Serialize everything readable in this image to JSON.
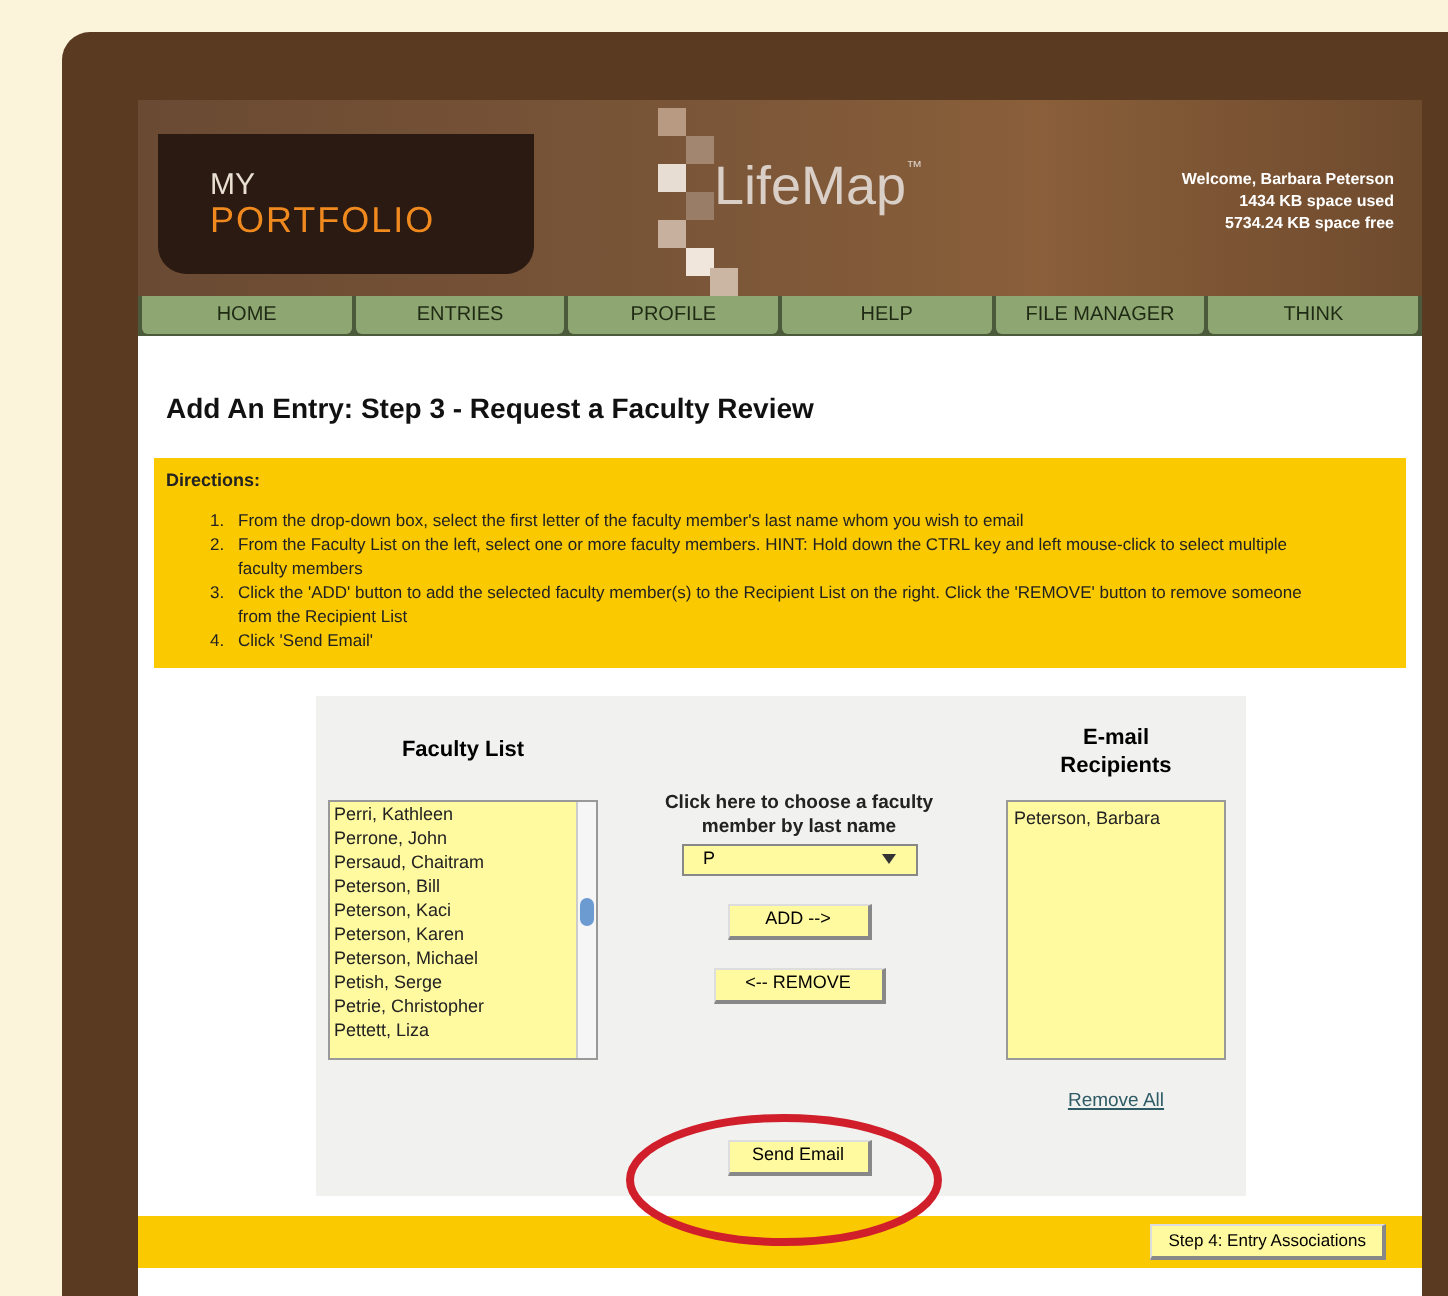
{
  "header": {
    "logo_top": "MY",
    "logo_bottom": "PORTFOLIO",
    "brand": "LifeMap",
    "brand_mark": "™",
    "welcome": "Welcome, Barbara Peterson",
    "space_used": "1434 KB space used",
    "space_free": "5734.24 KB space free"
  },
  "nav": [
    "HOME",
    "ENTRIES",
    "PROFILE",
    "HELP",
    "FILE MANAGER",
    "THINK"
  ],
  "title": "Add An Entry: Step 3 - Request a Faculty Review",
  "directions": {
    "heading": "Directions:",
    "steps": [
      {
        "number": "1.",
        "text": "From the drop-down box, select the first letter of the faculty member's last name whom you wish to email"
      },
      {
        "number": "2.",
        "text": "From the Faculty List on the left, select one or more faculty members. HINT: Hold down the CTRL key and left mouse-click to select multiple faculty members"
      },
      {
        "number": "3.",
        "text": "Click the 'ADD' button to add the selected faculty member(s) to the Recipient List on the right. Click the 'REMOVE' button to remove someone from the Recipient List"
      },
      {
        "number": "4.",
        "text": "Click 'Send Email'"
      }
    ]
  },
  "faculty_list": {
    "heading": "Faculty List",
    "items": [
      "Perri, Kathleen",
      "Perrone, John",
      "Persaud, Chaitram",
      "Peterson, Bill",
      "Peterson, Kaci",
      "Peterson, Karen",
      "Peterson, Michael",
      "Petish, Serge",
      "Petrie, Christopher",
      "Pettett, Liza"
    ]
  },
  "chooser": {
    "label": "Click here to choose a faculty member by last name",
    "value": "P",
    "add": "ADD -->",
    "remove": "<-- REMOVE"
  },
  "recipients": {
    "heading": "E-mail Recipients",
    "items": [
      "Peterson, Barbara"
    ],
    "remove_all": "Remove All"
  },
  "send": "Send Email",
  "next": "Step 4: Entry Associations"
}
